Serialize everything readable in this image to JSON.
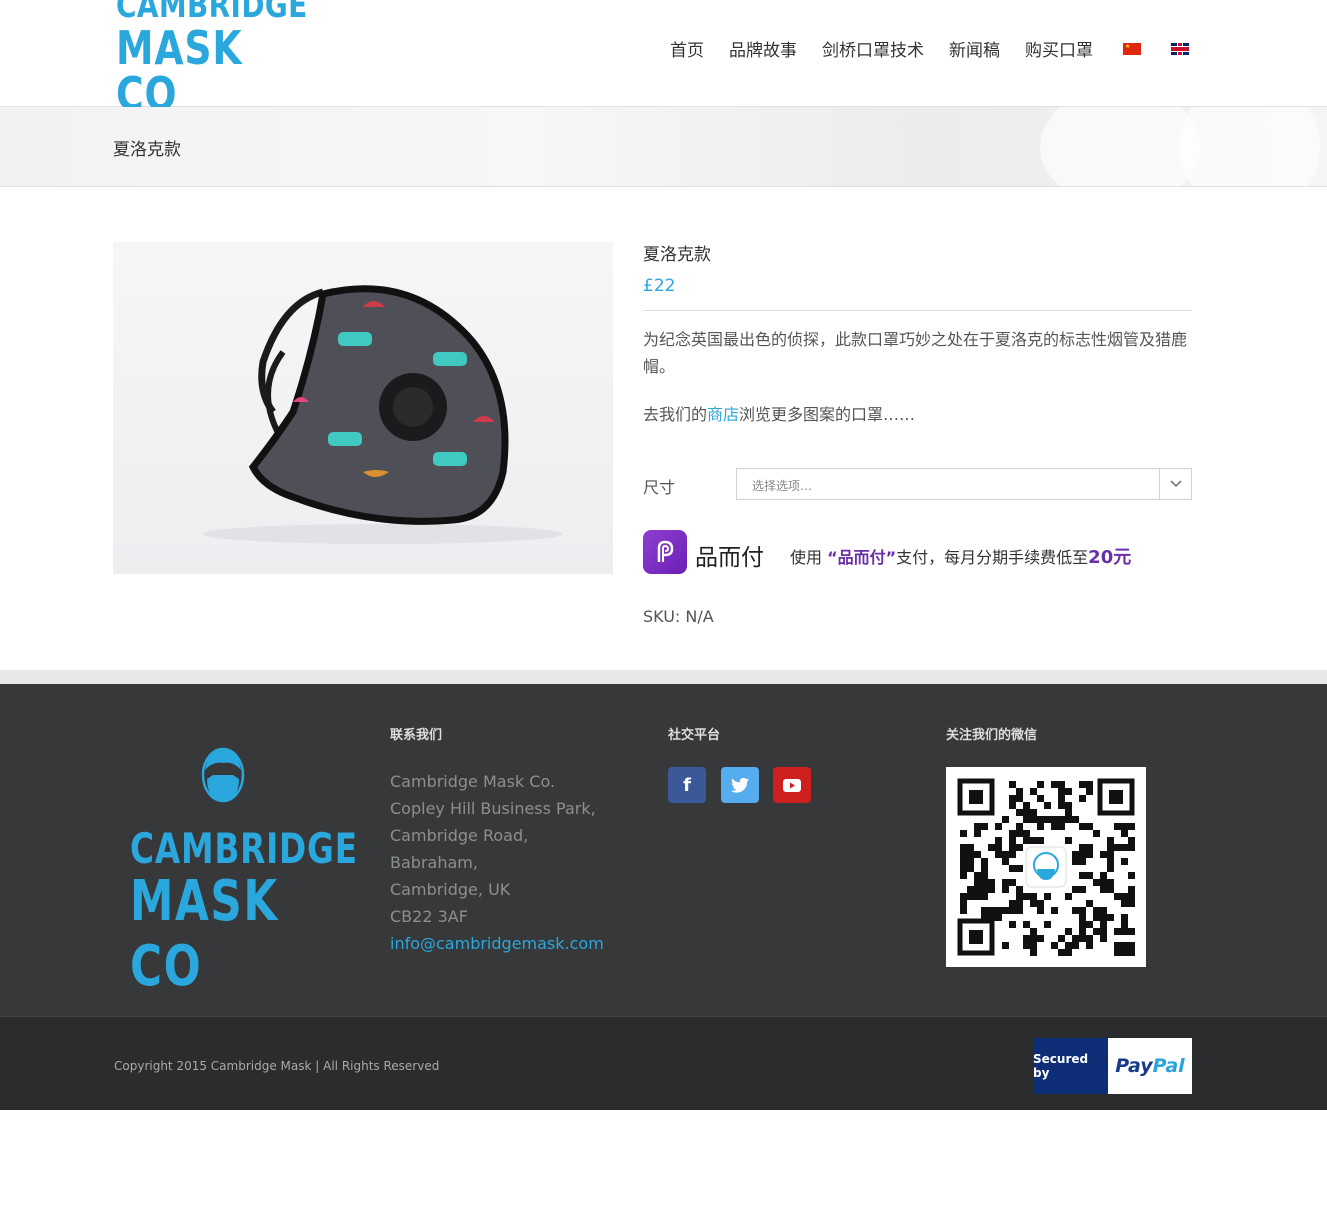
{
  "header": {
    "logo": {
      "line1": "CAMBRIDGE",
      "line2": "MASK CO"
    },
    "nav": [
      "首页",
      "品牌故事",
      "剑桥口罩技术",
      "新闻稿",
      "购买口罩"
    ],
    "flags": [
      "cn-flag-icon",
      "uk-flag-icon"
    ]
  },
  "page": {
    "title": "夏洛克款"
  },
  "product": {
    "name": "夏洛克款",
    "price": "£22",
    "description": "为纪念英国最出色的侦探，此款口罩巧妙之处在于夏洛克的标志性烟管及猎鹿帽。",
    "shop_prefix": "去我们的",
    "shop_link": "商店",
    "shop_suffix": "浏览更多图案的口罩……",
    "size_label": "尺寸",
    "size_placeholder": "选择选项…",
    "sku": "SKU: N/A"
  },
  "installment": {
    "brand": "品而付",
    "text_prefix": "使用",
    "text_brand": "“品而付”",
    "text_mid": "支付，每月分期手续费低至",
    "text_amount": "20元",
    "accent_color": "#6a2fa8"
  },
  "footer": {
    "logo": {
      "line1": "CAMBRIDGE",
      "line2": "MASK CO"
    },
    "contact_heading": "联系我们",
    "address": [
      "Cambridge Mask Co.",
      "Copley Hill Business Park,",
      "Cambridge Road,",
      "Babraham,",
      "Cambridge, UK",
      "CB22 3AF"
    ],
    "email": "info@cambridgemask.com",
    "social_heading": "社交平台",
    "social": [
      {
        "name": "facebook-icon",
        "glyph": "f",
        "color": "#3b5998"
      },
      {
        "name": "twitter-icon",
        "glyph": "🐦",
        "color": "#55acee"
      },
      {
        "name": "youtube-icon",
        "glyph": "▶",
        "color": "#cd201f"
      }
    ],
    "wechat_heading": "关注我们的微信",
    "copyright": "Copyright 2015 Cambridge Mask | All Rights Reserved",
    "paypal": {
      "secured": "Secured by",
      "pay": "Pay",
      "pal": "Pal"
    }
  },
  "colors": {
    "brand": "#2aa7dd",
    "footer_bg": "#363839"
  }
}
